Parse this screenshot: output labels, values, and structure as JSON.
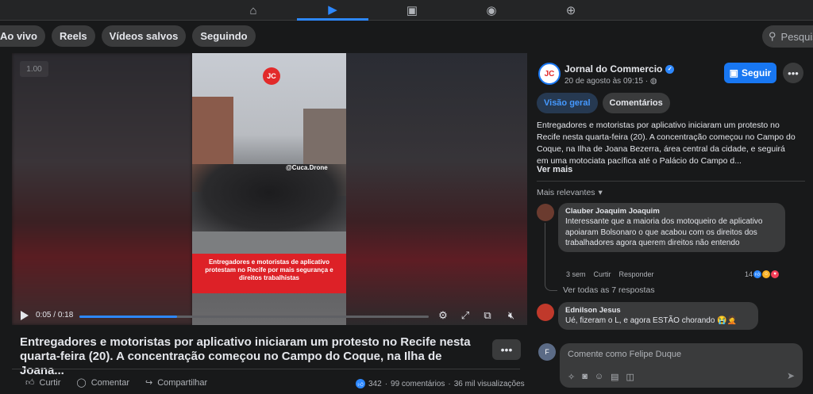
{
  "nav": {
    "icons": [
      "home-icon",
      "watch-icon",
      "marketplace-icon",
      "groups-icon",
      "gaming-icon"
    ],
    "active": "watch-icon"
  },
  "chips": [
    "Ao vivo",
    "Reels",
    "Vídeos salvos",
    "Seguindo"
  ],
  "search": {
    "placeholder": "Pesquisa"
  },
  "player": {
    "speed_badge": "1.00",
    "current_time": "0:05",
    "duration": "0:18",
    "time_separator": " / ",
    "progress": 0.28,
    "logo_text": "JC",
    "watermark": "@Cuca.Drone",
    "overlay_text": "Entregadores e motoristas de aplicativo protestam no Recife por mais segurança e direitos trabalhistas"
  },
  "post": {
    "caption": "Entregadores e motoristas por aplicativo iniciaram um protesto no Recife nesta quarta-feira (20). A concentração começou no Campo do Coque, na Ilha de Joana...",
    "actions": {
      "like": "Curtir",
      "comment": "Comentar",
      "share": "Compartilhar"
    },
    "stats": {
      "reactions": "342",
      "comments": "99 comentários",
      "views": "36 mil visualizações",
      "separator": "·"
    }
  },
  "panel": {
    "page_name": "Jornal do Commercio",
    "avatar_text": "JC",
    "date": "20 de agosto às 09:15 · ",
    "follow_label": "Seguir",
    "tabs": [
      "Visão geral",
      "Comentários"
    ],
    "description": "Entregadores e motoristas por aplicativo iniciaram um protesto no Recife nesta quarta-feira (20). A concentração começou no Campo do Coque, na Ilha de Joana Bezerra, área central da cidade, e seguirá em uma motociata pacífica até o Palácio do Campo d...",
    "see_more": "Ver mais",
    "sort_label": "Mais relevantes"
  },
  "comments": [
    {
      "name": "Clauber Joaquim Joaquim",
      "text": "Interessante que a maioria dos motoqueiro de aplicativo apoiaram Bolsonaro o que acabou com os direitos dos trabalhadores agora querem direitos não entendo",
      "time": "3 sem",
      "like": "Curtir",
      "reply": "Responder",
      "reactions": "14",
      "view_replies": "Ver todas as 7 respostas"
    },
    {
      "name": "Ednilson Jesus",
      "text": "Ué, fizeram o L, e agora ESTÃO chorando 😭🤦"
    }
  ],
  "composer": {
    "placeholder": "Comente como Felipe Duque",
    "tools": [
      "sticker-icon",
      "camera-icon",
      "emoji-icon",
      "gif-icon",
      "post-sticker-icon"
    ]
  }
}
